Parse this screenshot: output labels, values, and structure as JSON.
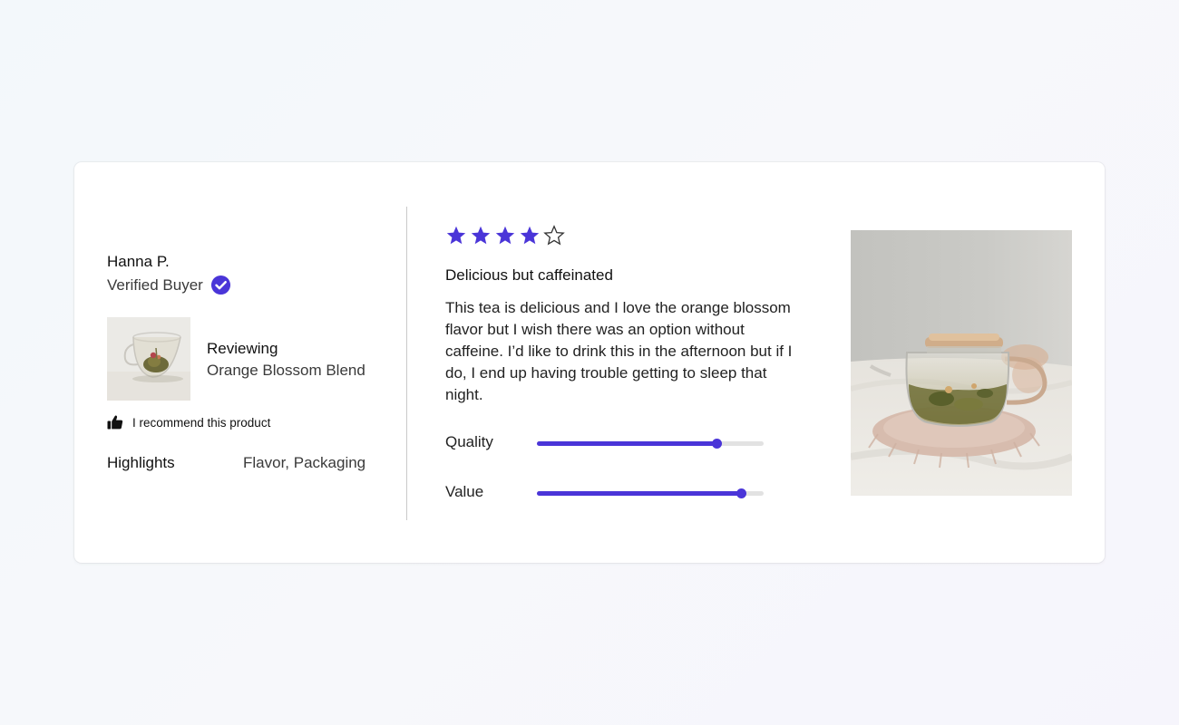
{
  "colors": {
    "accent": "#4a35d8",
    "track": "#e2e2e2",
    "background": "#f5f7fb"
  },
  "reviewer": {
    "name": "Hanna P.",
    "badge": "Verified Buyer",
    "badge_icon": "verified-check-icon"
  },
  "product": {
    "reviewing_label": "Reviewing",
    "name": "Orange Blossom Blend",
    "thumbnail": "tea-glass-cup-image"
  },
  "recommend": {
    "icon": "thumbs-up-icon",
    "text": "I recommend this product"
  },
  "highlights": {
    "label": "Highlights",
    "value": "Flavor, Packaging"
  },
  "review": {
    "rating": 4,
    "max_rating": 5,
    "title": "Delicious but caffeinated",
    "body": "This tea is delicious and I love the orange blossom flavor but I wish there was an option without caffeine. I’d like to drink this in the afternoon but if I do, I end up having trouble getting to sleep that night."
  },
  "ratings": [
    {
      "label": "Quality",
      "value": 0.79
    },
    {
      "label": "Value",
      "value": 0.9
    }
  ],
  "photo": {
    "subject": "glass-teapot-photo"
  }
}
